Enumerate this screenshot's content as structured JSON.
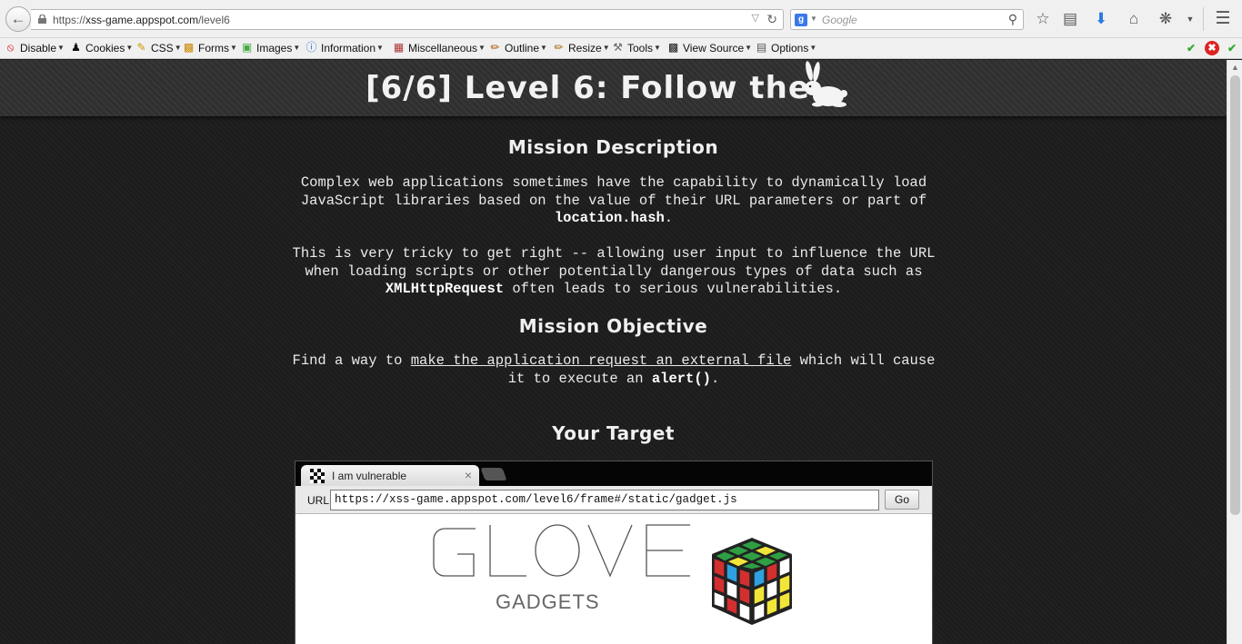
{
  "browser": {
    "url_prefix": "https://",
    "url_host": "xss-game.appspot.com",
    "url_path": "/level6",
    "search_placeholder": "Google"
  },
  "devbar": {
    "items": [
      {
        "label": "Disable",
        "icon": "disable-icon",
        "color": "#d11"
      },
      {
        "label": "Cookies",
        "icon": "cookies-icon",
        "color": "#333"
      },
      {
        "label": "CSS",
        "icon": "css-icon",
        "color": "#c90"
      },
      {
        "label": "Forms",
        "icon": "forms-icon",
        "color": "#c80"
      },
      {
        "label": "Images",
        "icon": "images-icon",
        "color": "#4a4"
      },
      {
        "label": "Information",
        "icon": "information-icon",
        "color": "#2a6ecf"
      },
      {
        "label": "Miscellaneous",
        "icon": "miscellaneous-icon",
        "color": "#a33"
      },
      {
        "label": "Outline",
        "icon": "outline-icon",
        "color": "#a50"
      },
      {
        "label": "Resize",
        "icon": "resize-icon",
        "color": "#a60"
      },
      {
        "label": "Tools",
        "icon": "tools-icon",
        "color": "#666"
      },
      {
        "label": "View Source",
        "icon": "view-source-icon",
        "color": "#333"
      },
      {
        "label": "Options",
        "icon": "options-icon",
        "color": "#555"
      }
    ]
  },
  "page": {
    "title": "[6/6]  Level 6: Follow the",
    "mission_heading": "Mission Description",
    "desc1_a": "Complex web applications sometimes have the capability to dynamically load JavaScript libraries based on the value of their URL parameters or part of ",
    "desc1_code": "location.hash",
    "desc1_b": ".",
    "desc2_a": "This is very tricky to get right -- allowing user input to influence the URL when loading scripts or other potentially dangerous types of data such as ",
    "desc2_code": "XMLHttpRequest",
    "desc2_b": " often leads to serious vulnerabilities.",
    "objective_heading": "Mission Objective",
    "obj_a": "Find a way to ",
    "obj_link": "make the application request an external file",
    "obj_b": " which will cause it to execute an ",
    "obj_code": "alert()",
    "obj_c": ".",
    "target_heading": "Your Target"
  },
  "frame": {
    "tab_title": "I am vulnerable",
    "url_label": "URL",
    "url_value": "https://xss-game.appspot.com/level6/frame#/static/gadget.js",
    "go_label": "Go",
    "logo_big": "GLOVE",
    "logo_small": "GADGETS"
  }
}
